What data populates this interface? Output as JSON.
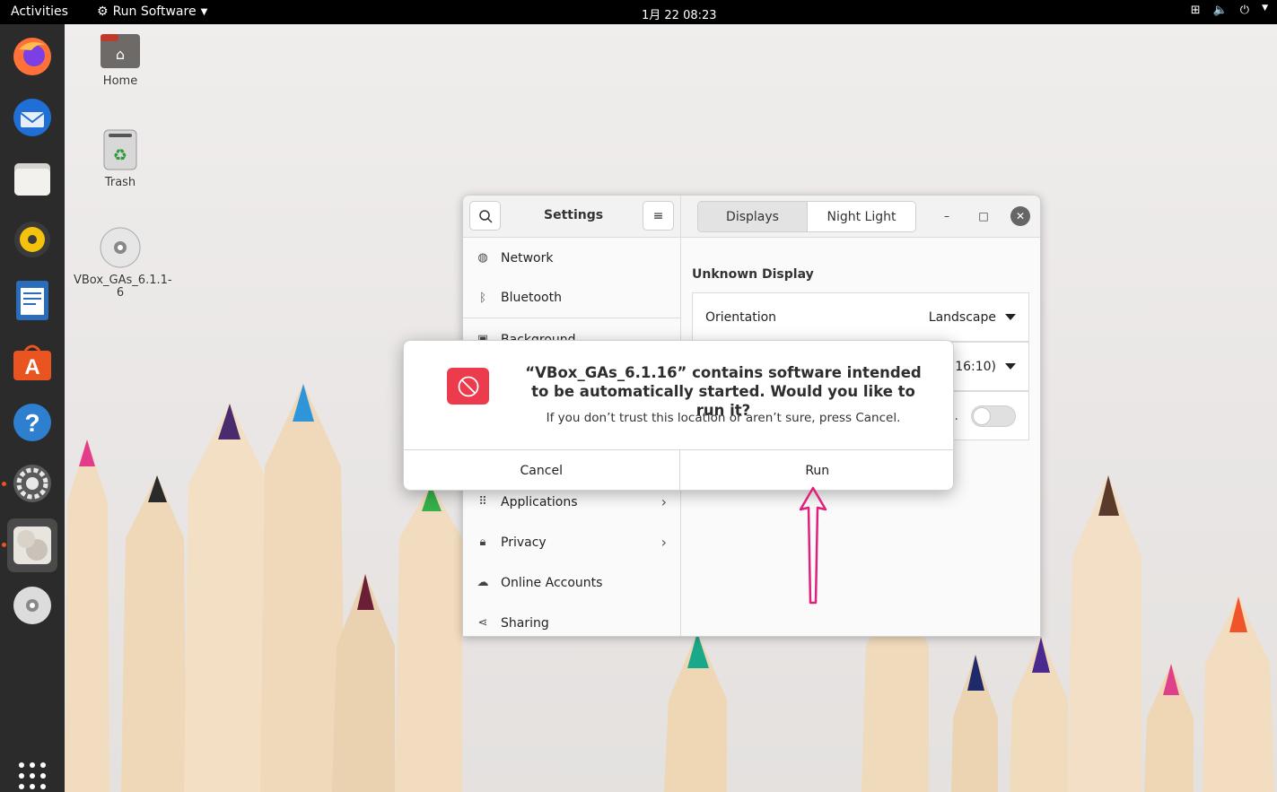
{
  "topbar": {
    "activities": "Activities",
    "app_menu": "Run Software",
    "clock": "1月 22  08:23"
  },
  "dock": {
    "items": [
      "firefox-icon",
      "thunderbird-icon",
      "files-icon",
      "rhythmbox-icon",
      "libreoffice-writer-icon",
      "ubuntu-software-icon",
      "help-icon",
      "settings-icon",
      "software-updater-icon",
      "optical-disc-icon",
      "show-applications-icon"
    ]
  },
  "desktop": {
    "home_label": "Home",
    "trash_label": "Trash",
    "disc_label": "VBox_GAs_6.1.1-6"
  },
  "settings": {
    "title": "Settings",
    "sidebar": {
      "network": "Network",
      "bluetooth": "Bluetooth",
      "background": "Background",
      "applications": "Applications",
      "privacy": "Privacy",
      "online_accounts": "Online Accounts",
      "sharing": "Sharing"
    },
    "tabs": {
      "displays": "Displays",
      "night_light": "Night Light"
    },
    "display_name": "Unknown Display",
    "orientation_label": "Orientation",
    "orientation_value": "Landscape",
    "resolution_value_partial": "16:10)",
    "scale_partial": "..."
  },
  "dialog": {
    "title": "“VBox_GAs_6.1.16” contains software intended to be automatically started. Would you like to run it?",
    "subtitle": "If you don’t trust this location or aren’t sure, press Cancel.",
    "cancel": "Cancel",
    "run": "Run",
    "icon_color": "#ec3b4c"
  },
  "annotation": {
    "arrow_color": "#e0207a"
  }
}
